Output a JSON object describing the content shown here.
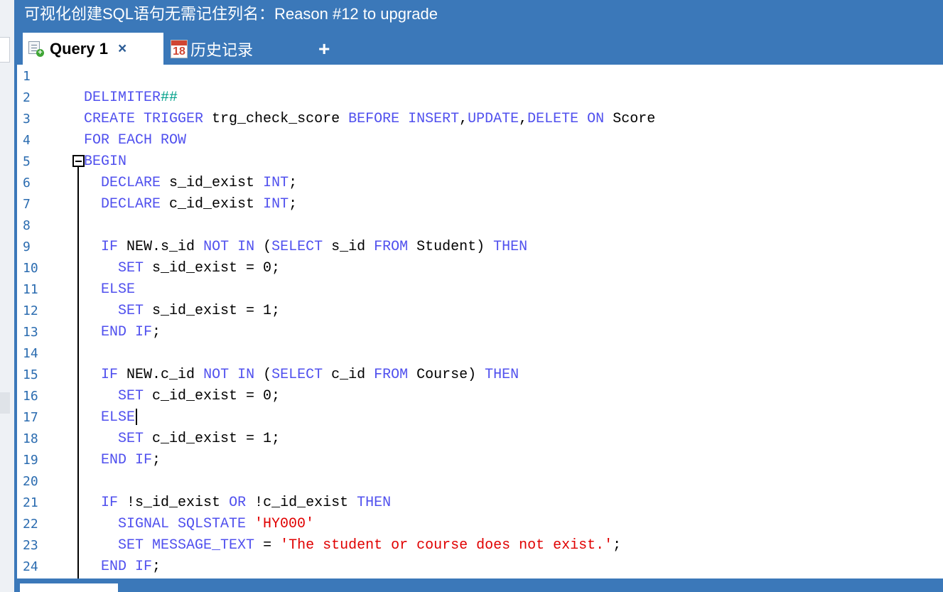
{
  "window": {
    "title": "可视化创建SQL语句无需记住列名：Reason #12 to upgrade"
  },
  "tabs": [
    {
      "label": "Query 1",
      "close": "×",
      "icon": "query-doc-icon"
    },
    {
      "label": "历史记录",
      "icon": "calendar-icon",
      "icon_text": "18"
    }
  ],
  "add_tab": "+",
  "editor": {
    "lines": [
      {
        "n": "1",
        "tokens": []
      },
      {
        "n": "2",
        "tokens": [
          [
            "kw",
            "    DELIMITER"
          ],
          [
            "op",
            "##"
          ]
        ]
      },
      {
        "n": "3",
        "tokens": [
          [
            "kw",
            "    CREATE TRIGGER "
          ],
          [
            "t",
            "trg_check_score "
          ],
          [
            "kw",
            "BEFORE INSERT"
          ],
          [
            "t",
            ","
          ],
          [
            "kw",
            "UPDATE"
          ],
          [
            "t",
            ","
          ],
          [
            "kw",
            "DELETE ON "
          ],
          [
            "t",
            "Score"
          ]
        ]
      },
      {
        "n": "4",
        "tokens": [
          [
            "kw",
            "    FOR EACH ROW"
          ]
        ]
      },
      {
        "n": "5",
        "tokens": [
          [
            "kw",
            "    BEGIN"
          ]
        ]
      },
      {
        "n": "6",
        "tokens": [
          [
            "kw",
            "      DECLARE "
          ],
          [
            "t",
            "s_id_exist "
          ],
          [
            "kw",
            "INT"
          ],
          [
            "t",
            ";"
          ]
        ]
      },
      {
        "n": "7",
        "tokens": [
          [
            "kw",
            "      DECLARE "
          ],
          [
            "t",
            "c_id_exist "
          ],
          [
            "kw",
            "INT"
          ],
          [
            "t",
            ";"
          ]
        ]
      },
      {
        "n": "8",
        "tokens": []
      },
      {
        "n": "9",
        "tokens": [
          [
            "kw",
            "      IF "
          ],
          [
            "t",
            "NEW.s_id "
          ],
          [
            "kw",
            "NOT IN "
          ],
          [
            "t",
            "("
          ],
          [
            "kw",
            "SELECT "
          ],
          [
            "t",
            "s_id "
          ],
          [
            "kw",
            "FROM "
          ],
          [
            "t",
            "Student) "
          ],
          [
            "kw",
            "THEN"
          ]
        ]
      },
      {
        "n": "10",
        "tokens": [
          [
            "kw",
            "        SET "
          ],
          [
            "t",
            "s_id_exist = 0;"
          ]
        ]
      },
      {
        "n": "11",
        "tokens": [
          [
            "kw",
            "      ELSE"
          ]
        ]
      },
      {
        "n": "12",
        "tokens": [
          [
            "kw",
            "        SET "
          ],
          [
            "t",
            "s_id_exist = 1;"
          ]
        ]
      },
      {
        "n": "13",
        "tokens": [
          [
            "kw",
            "      END IF"
          ],
          [
            "t",
            ";"
          ]
        ]
      },
      {
        "n": "14",
        "tokens": []
      },
      {
        "n": "15",
        "tokens": [
          [
            "kw",
            "      IF "
          ],
          [
            "t",
            "NEW.c_id "
          ],
          [
            "kw",
            "NOT IN "
          ],
          [
            "t",
            "("
          ],
          [
            "kw",
            "SELECT "
          ],
          [
            "t",
            "c_id "
          ],
          [
            "kw",
            "FROM "
          ],
          [
            "t",
            "Course) "
          ],
          [
            "kw",
            "THEN"
          ]
        ]
      },
      {
        "n": "16",
        "tokens": [
          [
            "kw",
            "        SET "
          ],
          [
            "t",
            "c_id_exist = 0;"
          ]
        ]
      },
      {
        "n": "17",
        "tokens": [
          [
            "kw",
            "      ELSE"
          ]
        ],
        "caret": true
      },
      {
        "n": "18",
        "tokens": [
          [
            "kw",
            "        SET "
          ],
          [
            "t",
            "c_id_exist = 1;"
          ]
        ]
      },
      {
        "n": "19",
        "tokens": [
          [
            "kw",
            "      END IF"
          ],
          [
            "t",
            ";"
          ]
        ]
      },
      {
        "n": "20",
        "tokens": []
      },
      {
        "n": "21",
        "tokens": [
          [
            "kw",
            "      IF "
          ],
          [
            "t",
            "!s_id_exist "
          ],
          [
            "kw",
            "OR "
          ],
          [
            "t",
            "!c_id_exist "
          ],
          [
            "kw",
            "THEN"
          ]
        ]
      },
      {
        "n": "22",
        "tokens": [
          [
            "kw",
            "        SIGNAL SQLSTATE "
          ],
          [
            "str",
            "'HY000'"
          ]
        ]
      },
      {
        "n": "23",
        "tokens": [
          [
            "kw",
            "        SET MESSAGE_TEXT "
          ],
          [
            "t",
            "= "
          ],
          [
            "str",
            "'The student or course does not exist.'"
          ],
          [
            "t",
            ";"
          ]
        ]
      },
      {
        "n": "24",
        "tokens": [
          [
            "kw",
            "      END IF"
          ],
          [
            "t",
            ";"
          ]
        ]
      }
    ]
  },
  "colors": {
    "brand_blue": "#3b78b9",
    "keyword": "#5050ee",
    "string": "#e00000",
    "delimiter_symbol": "#00a08a",
    "line_number": "#2b6cb0"
  }
}
